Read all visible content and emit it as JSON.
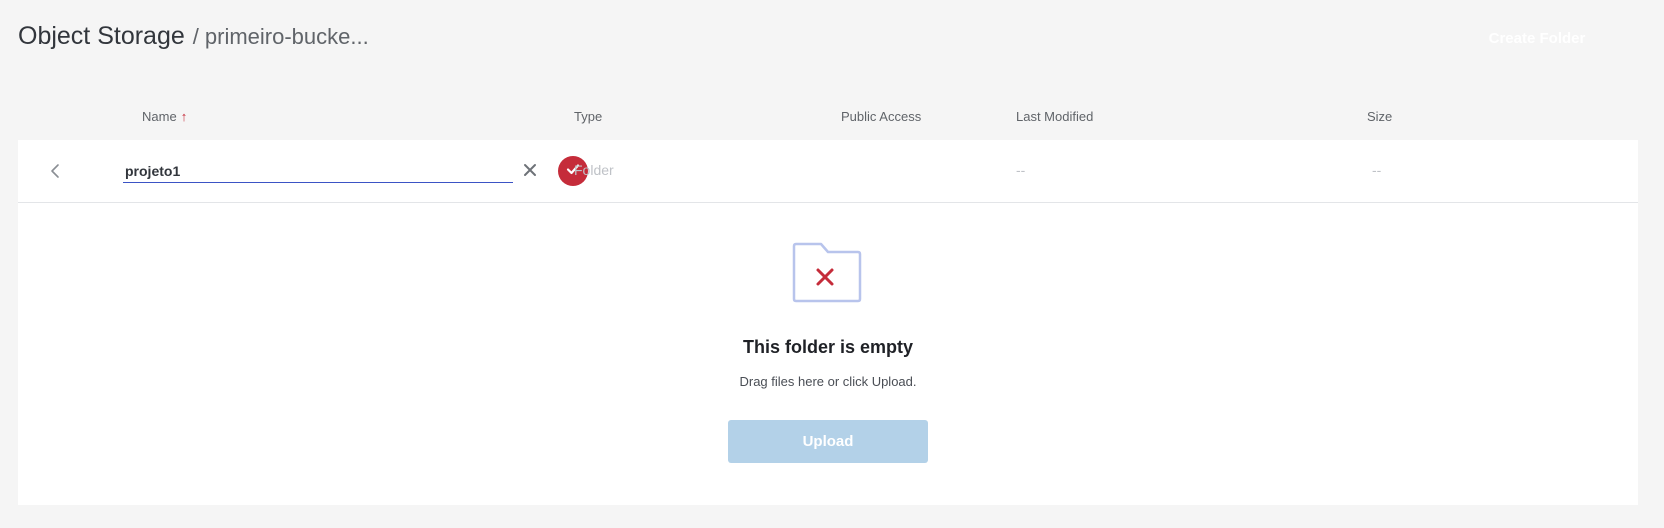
{
  "header": {
    "title": "Object Storage",
    "separator": "/",
    "breadcrumb": "primeiro-bucke...",
    "create_folder_label": "Create Folder"
  },
  "table": {
    "columns": [
      "Name",
      "Type",
      "Public Access",
      "Last Modified",
      "Size"
    ],
    "sort_column": "Name",
    "sort_direction": "ascending",
    "new_row": {
      "name_value": "projeto1",
      "type": "Folder",
      "public_access": "",
      "last_modified": "--",
      "size": "--"
    }
  },
  "empty_state": {
    "title": "This folder is empty",
    "subtitle": "Drag files here or click Upload.",
    "upload_label": "Upload"
  },
  "colors": {
    "accent": "#c52c3a",
    "input_underline": "#3b53c5",
    "upload_disabled": "#b3d1e8",
    "folder_outline": "#b8c4ec"
  },
  "icons": [
    "chevron-left-icon",
    "close-icon",
    "check-icon",
    "empty-folder-icon",
    "sort-up-icon"
  ]
}
